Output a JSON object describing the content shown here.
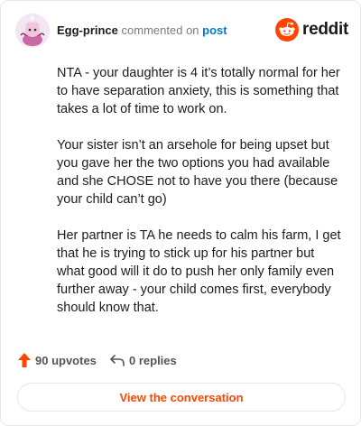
{
  "header": {
    "author": "Egg-prince",
    "action_text": "commented on",
    "post_link": "post"
  },
  "brand": {
    "icon": "reddit-logo-icon",
    "wordmark": "reddit",
    "color": "#ff4500"
  },
  "comment": {
    "paragraphs": [
      "NTA - your daughter is 4 it’s totally normal for her to have separation anxiety, this is something that takes a lot of time to work on.",
      "Your sister isn’t an arsehole for being upset but you gave her the two options you had available and she CHOSE not to have you there (because your child can’t go)",
      "Her partner is TA he needs to calm his farm, I get that he is trying to stick up for his partner but what good will it do to push her only family even further away - your child comes first, everybody should know that."
    ]
  },
  "actions": {
    "upvotes": "90 upvotes",
    "replies": "0 replies",
    "upvote_icon": "arrow-up-icon",
    "reply_icon": "reply-arrow-icon",
    "upvote_color": "#ff4500"
  },
  "footer": {
    "view_label": "View the conversation"
  }
}
